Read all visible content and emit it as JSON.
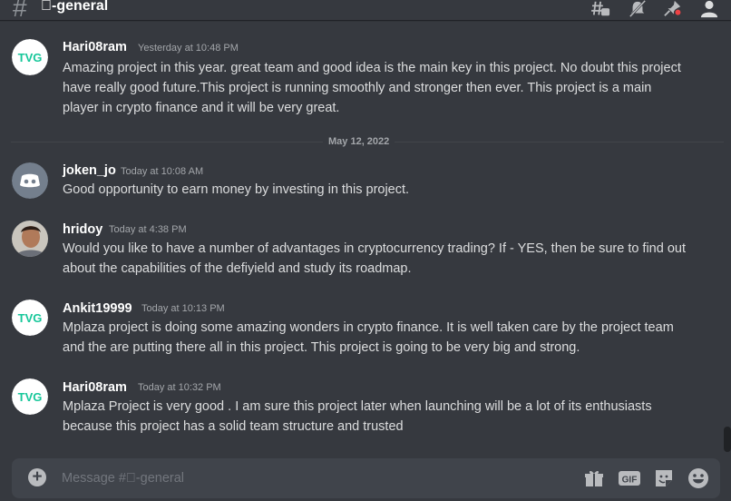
{
  "header": {
    "hash": "#",
    "channel_name": "\u0000-general"
  },
  "divider": {
    "label": "May 12, 2022"
  },
  "messages": [
    {
      "author": "Hari08ram",
      "timestamp": "Yesterday at 10:48 PM",
      "avatar": "tvg-logo",
      "text": "Amazing project in this year. great team and good idea is the main key in this project. No doubt this project have really good future.This project is running smoothly and stronger then ever. This project is a main player in crypto finance and it will be very great."
    },
    {
      "author": "joken_jo",
      "timestamp": "Today at 10:08 AM",
      "avatar": "discord-default",
      "text": "Good opportunity to earn money by investing in this project."
    },
    {
      "author": "hridoy",
      "timestamp": "Today at 4:38 PM",
      "avatar": "photo",
      "text": "Would you like to have a number of advantages in cryptocurrency trading? If - YES, then be sure to find out about the capabilities of the defiyield and study its roadmap."
    },
    {
      "author": "Ankit19999",
      "timestamp": "Today at 10:13 PM",
      "avatar": "tvg-logo",
      "text": "Mplaza project is doing some amazing wonders in crypto finance. It is well taken care by the project team and the are putting there all in this project. This project is going to be very big and strong."
    },
    {
      "author": "Hari08ram",
      "timestamp": "Today at 10:32 PM",
      "avatar": "tvg-logo",
      "text": "Mplaza Project is very good . I am sure this project later when launching will be a lot of its enthusiasts because this project has a solid team structure and trusted"
    }
  ],
  "composer": {
    "placeholder": "Message #\u0000-general",
    "icons": [
      "plus-icon",
      "gift-icon",
      "gif-icon",
      "sticker-icon",
      "emoji-icon"
    ],
    "gif_label": "GIF"
  },
  "colors": {
    "background": "#36393f",
    "composer": "#40444b",
    "text": "#dcddde",
    "muted": "#a3a6aa",
    "tvg_green": "#16c79a",
    "discord_blurple": "#5865f2",
    "unread_red": "#ed4245"
  }
}
